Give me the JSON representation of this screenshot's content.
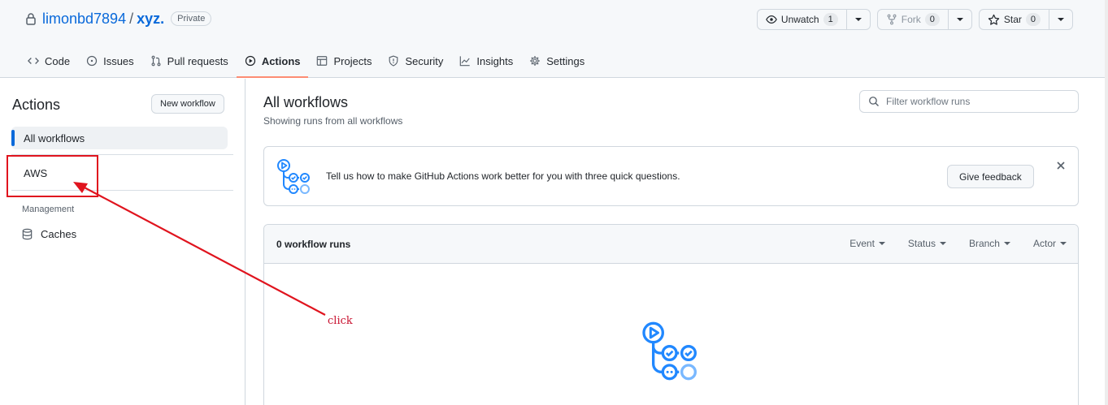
{
  "repo": {
    "owner": "limonbd7894",
    "separator": "/",
    "name": "xyz.",
    "visibility": "Private"
  },
  "header_actions": {
    "watch": {
      "label": "Unwatch",
      "count": "1"
    },
    "fork": {
      "label": "Fork",
      "count": "0"
    },
    "star": {
      "label": "Star",
      "count": "0"
    }
  },
  "tabs": [
    {
      "label": "Code",
      "icon": "code-icon"
    },
    {
      "label": "Issues",
      "icon": "issue-icon"
    },
    {
      "label": "Pull requests",
      "icon": "pull-request-icon"
    },
    {
      "label": "Actions",
      "icon": "play-icon",
      "active": true
    },
    {
      "label": "Projects",
      "icon": "table-icon"
    },
    {
      "label": "Security",
      "icon": "shield-icon"
    },
    {
      "label": "Insights",
      "icon": "graph-icon"
    },
    {
      "label": "Settings",
      "icon": "gear-icon"
    }
  ],
  "sidebar": {
    "title": "Actions",
    "new_workflow": "New workflow",
    "items": [
      {
        "label": "All workflows",
        "active": true
      },
      {
        "label": "AWS"
      }
    ],
    "section": "Management",
    "caches": "Caches"
  },
  "main": {
    "title": "All workflows",
    "subtitle": "Showing runs from all workflows",
    "filter_placeholder": "Filter workflow runs"
  },
  "feedback": {
    "message": "Tell us how to make GitHub Actions work better for you with three quick questions.",
    "button": "Give feedback"
  },
  "runs": {
    "count_label": "0 workflow runs",
    "filters": [
      "Event",
      "Status",
      "Branch",
      "Actor"
    ]
  },
  "annotation": {
    "text": "click",
    "color": "#e0141e"
  }
}
